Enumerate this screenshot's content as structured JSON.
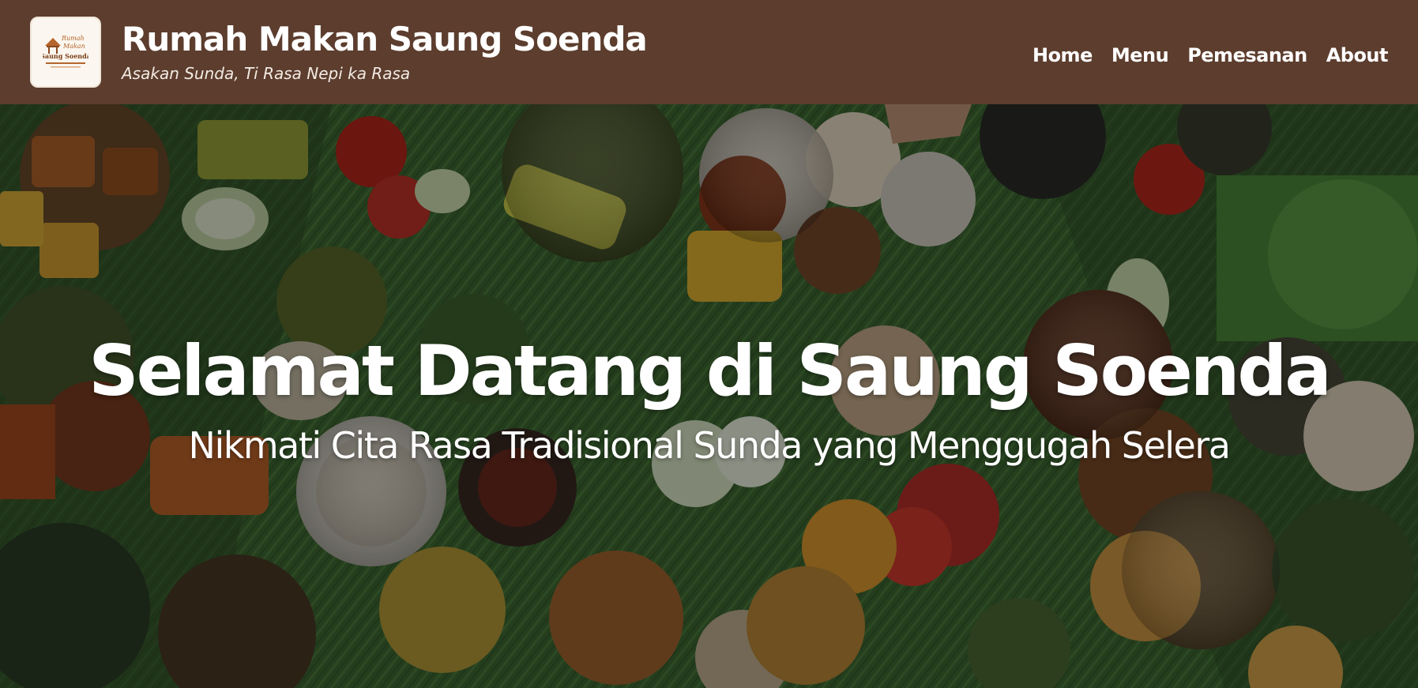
{
  "header": {
    "logo": {
      "icon": "saung-hut-icon",
      "script_line1": "Rumah",
      "script_line2": "Makan",
      "name": "Saung Soenda"
    },
    "title": "Rumah Makan Saung Soenda",
    "tagline": "Asakan Sunda, Ti Rasa Nepi ka Rasa",
    "nav": [
      {
        "label": "Home"
      },
      {
        "label": "Menu"
      },
      {
        "label": "Pemesanan"
      },
      {
        "label": "About"
      }
    ]
  },
  "hero": {
    "title": "Selamat Datang di Saung Soenda",
    "subtitle": "Nikmati Cita Rasa Tradisional Sunda yang Menggugah Selera",
    "background": "sundanese-food-spread-on-banana-leaf-photo"
  },
  "colors": {
    "header_bg": "#5c3d2e",
    "logo_bg": "#fbf6ef",
    "logo_accent": "#b5652c",
    "text_light": "#ffffff",
    "leaf_green": "#3e6a34"
  }
}
